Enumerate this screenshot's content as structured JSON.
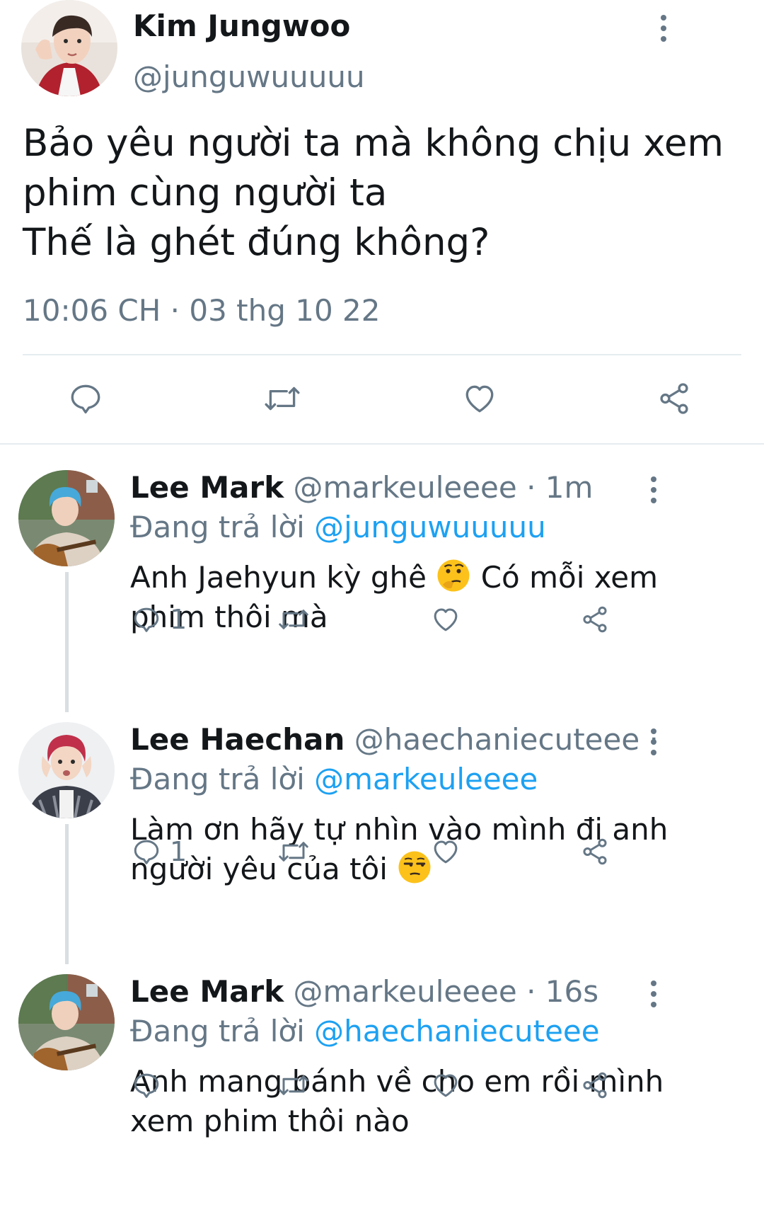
{
  "main_tweet": {
    "author_name": "Kim Jungwoo",
    "author_handle": "@junguwuuuuu",
    "text_lines": [
      "Bảo yêu người ta mà không chịu xem",
      "phim cùng người ta",
      "Thế là ghét đúng không?"
    ],
    "timestamp": "10:06 CH · 03 thg 10 22"
  },
  "replies": [
    {
      "name": "Lee Mark",
      "handle": "@markeuleeee",
      "time": " · 1m",
      "replying_label": "Đang trả lời ",
      "replying_to": "@junguwuuuuu",
      "text_line1": "Anh Jaehyun kỳ ghê ",
      "text_line1_after": " Có mỗi xem",
      "text_line2": "phim thôi mà",
      "emoji": "thinking-face",
      "reply_count": "1"
    },
    {
      "name": "Lee Haechan",
      "handle": "@haechaniecuteee",
      "time": " · ...",
      "replying_label": "Đang trả lời ",
      "replying_to": "@markeuleeee",
      "text_line1": "Làm ơn hãy tự nhìn vào mình đi anh",
      "text_line2": "người yêu của tôi ",
      "emoji": "unamused-face",
      "reply_count": "1"
    },
    {
      "name": "Lee Mark",
      "handle": "@markeuleeee",
      "time": " · 16s",
      "replying_label": "Đang trả lời ",
      "replying_to": "@haechaniecuteee",
      "text_line1": "Anh mang bánh về cho em rồi mình",
      "text_line2": "xem phim thôi nào",
      "reply_count": ""
    }
  ],
  "colors": {
    "primary_text": "#14171a",
    "secondary_text": "#657786",
    "link": "#1da1f2",
    "divider": "#e6ecf0"
  },
  "icons": [
    "reply-icon",
    "retweet-icon",
    "like-icon",
    "share-icon",
    "more-options-icon"
  ]
}
